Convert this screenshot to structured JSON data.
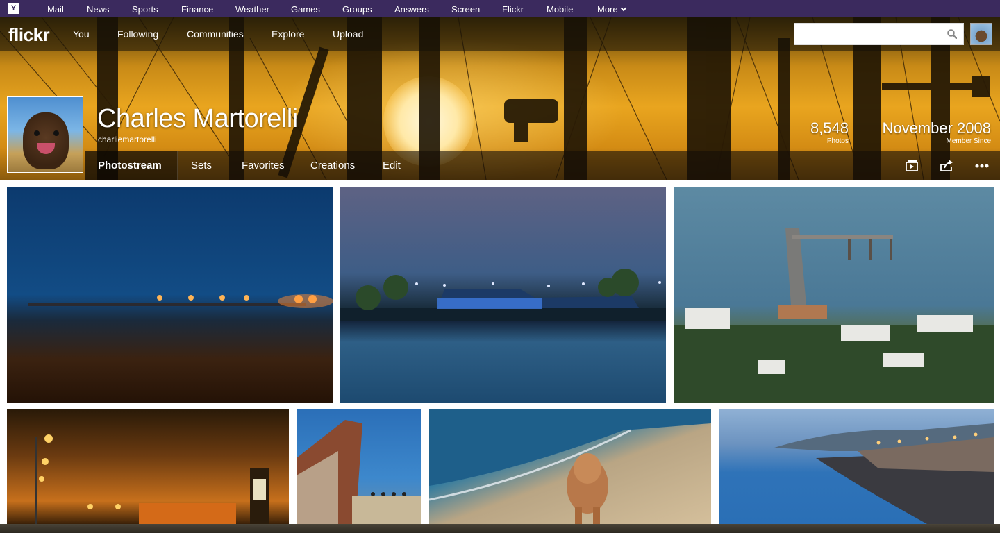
{
  "yahoo_bar": {
    "logo": "Y",
    "links": [
      "Mail",
      "News",
      "Sports",
      "Finance",
      "Weather",
      "Games",
      "Groups",
      "Answers",
      "Screen",
      "Flickr",
      "Mobile",
      "More"
    ]
  },
  "flickr_nav": {
    "logo": "flickr",
    "links": [
      "You",
      "Following",
      "Communities",
      "Explore",
      "Upload"
    ],
    "search": {
      "value": "",
      "placeholder": ""
    }
  },
  "profile": {
    "name": "Charles Martorelli",
    "username": "charliemartorelli",
    "stats": [
      {
        "value": "8,548",
        "label": "Photos"
      },
      {
        "value": "November 2008",
        "label": "Member Since"
      }
    ]
  },
  "subnav": {
    "tabs": [
      "Photostream",
      "Sets",
      "Favorites",
      "Creations",
      "Edit"
    ],
    "active_tab": "Photostream",
    "icons": [
      "slideshow-icon",
      "share-icon",
      "more-icon"
    ]
  },
  "photos": [
    {
      "subject": "pier at night beach"
    },
    {
      "subject": "lit pavilion over water at dusk"
    },
    {
      "subject": "pier and coastal town aerial"
    },
    {
      "subject": "orange lights night street"
    },
    {
      "subject": "brick ruin wall with birds"
    },
    {
      "subject": "dog on beach"
    },
    {
      "subject": "coastline seawall at dusk"
    }
  ],
  "colors": {
    "yahoo_purple": "#3b2a5e",
    "cover_gold": "#e9a51f"
  }
}
